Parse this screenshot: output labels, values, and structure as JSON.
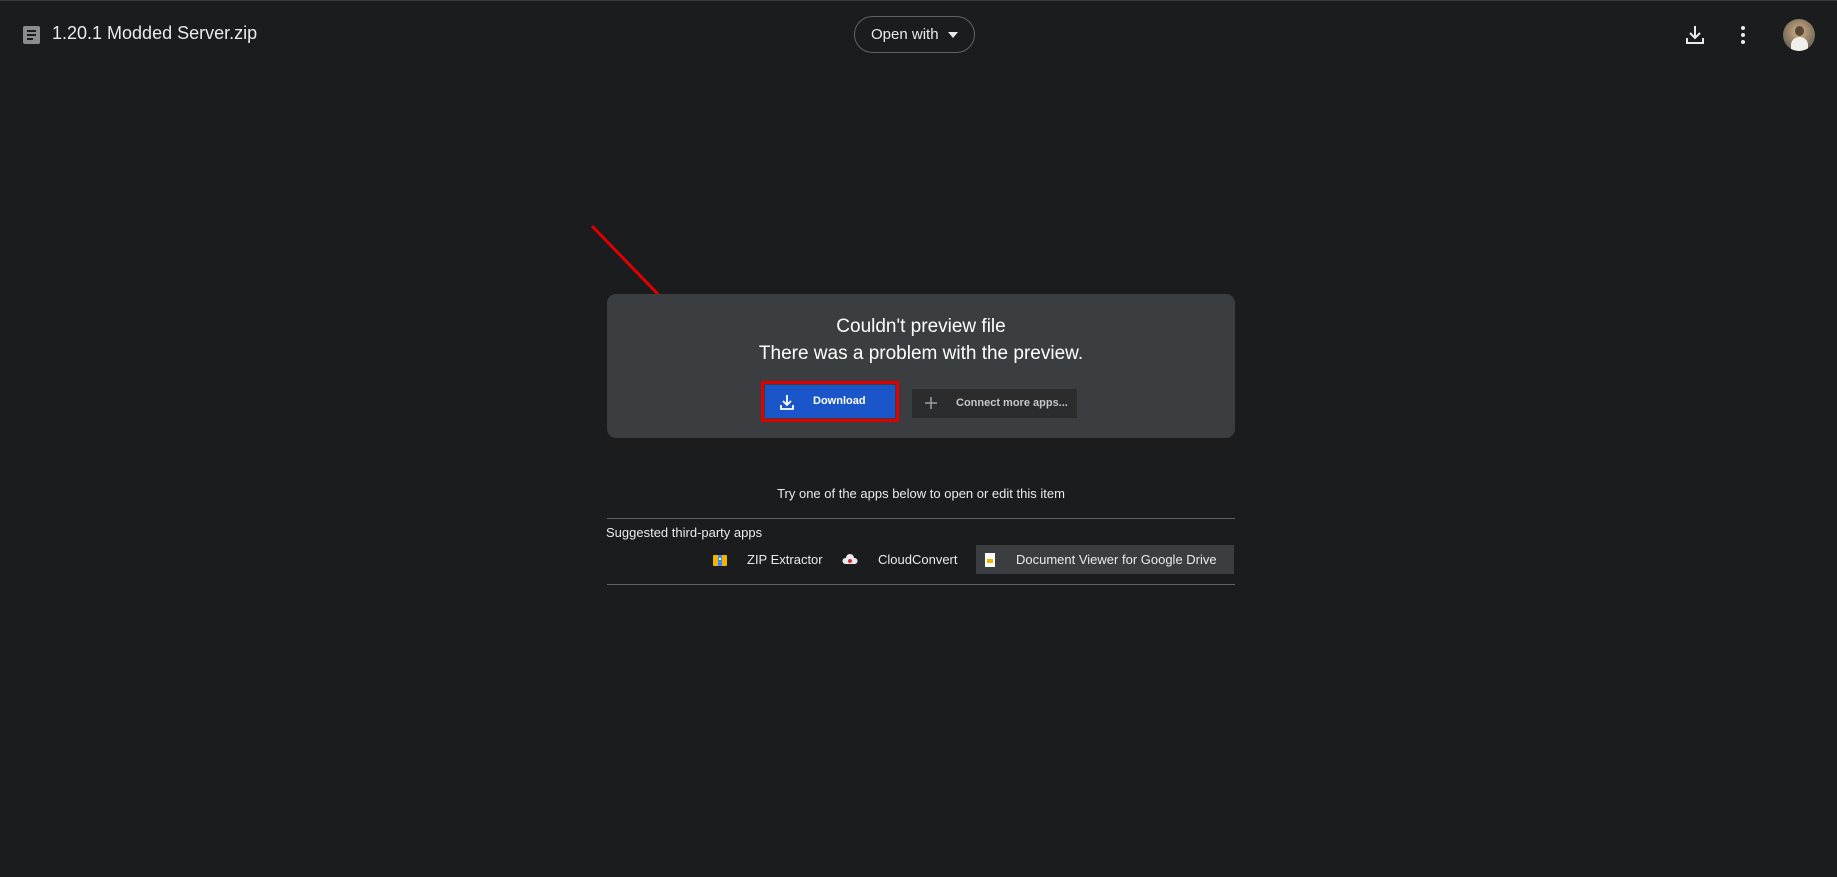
{
  "header": {
    "file_title": "1.20.1 Modded Server.zip",
    "file_icon": "zip-file-icon",
    "open_with_label": "Open with",
    "download_icon": "download-icon",
    "more_icon": "more-vert-icon",
    "avatar": "account-avatar"
  },
  "preview_error": {
    "title": "Couldn't preview file",
    "message": "There was a problem with the preview.",
    "download_label": "Download",
    "connect_label": "Connect more apps..."
  },
  "suggestions": {
    "prompt": "Try one of the apps below to open or edit this item",
    "section_label": "Suggested third-party apps",
    "apps": [
      {
        "label": "ZIP Extractor",
        "icon": "zip-extractor-icon"
      },
      {
        "label": "CloudConvert",
        "icon": "cloudconvert-icon"
      },
      {
        "label": "Document Viewer for Google Drive",
        "icon": "document-viewer-icon"
      }
    ]
  },
  "colors": {
    "background": "#1b1c1e",
    "card": "#3b3e40",
    "primary_button": "#1a56c9",
    "annotation": "#e00000"
  }
}
